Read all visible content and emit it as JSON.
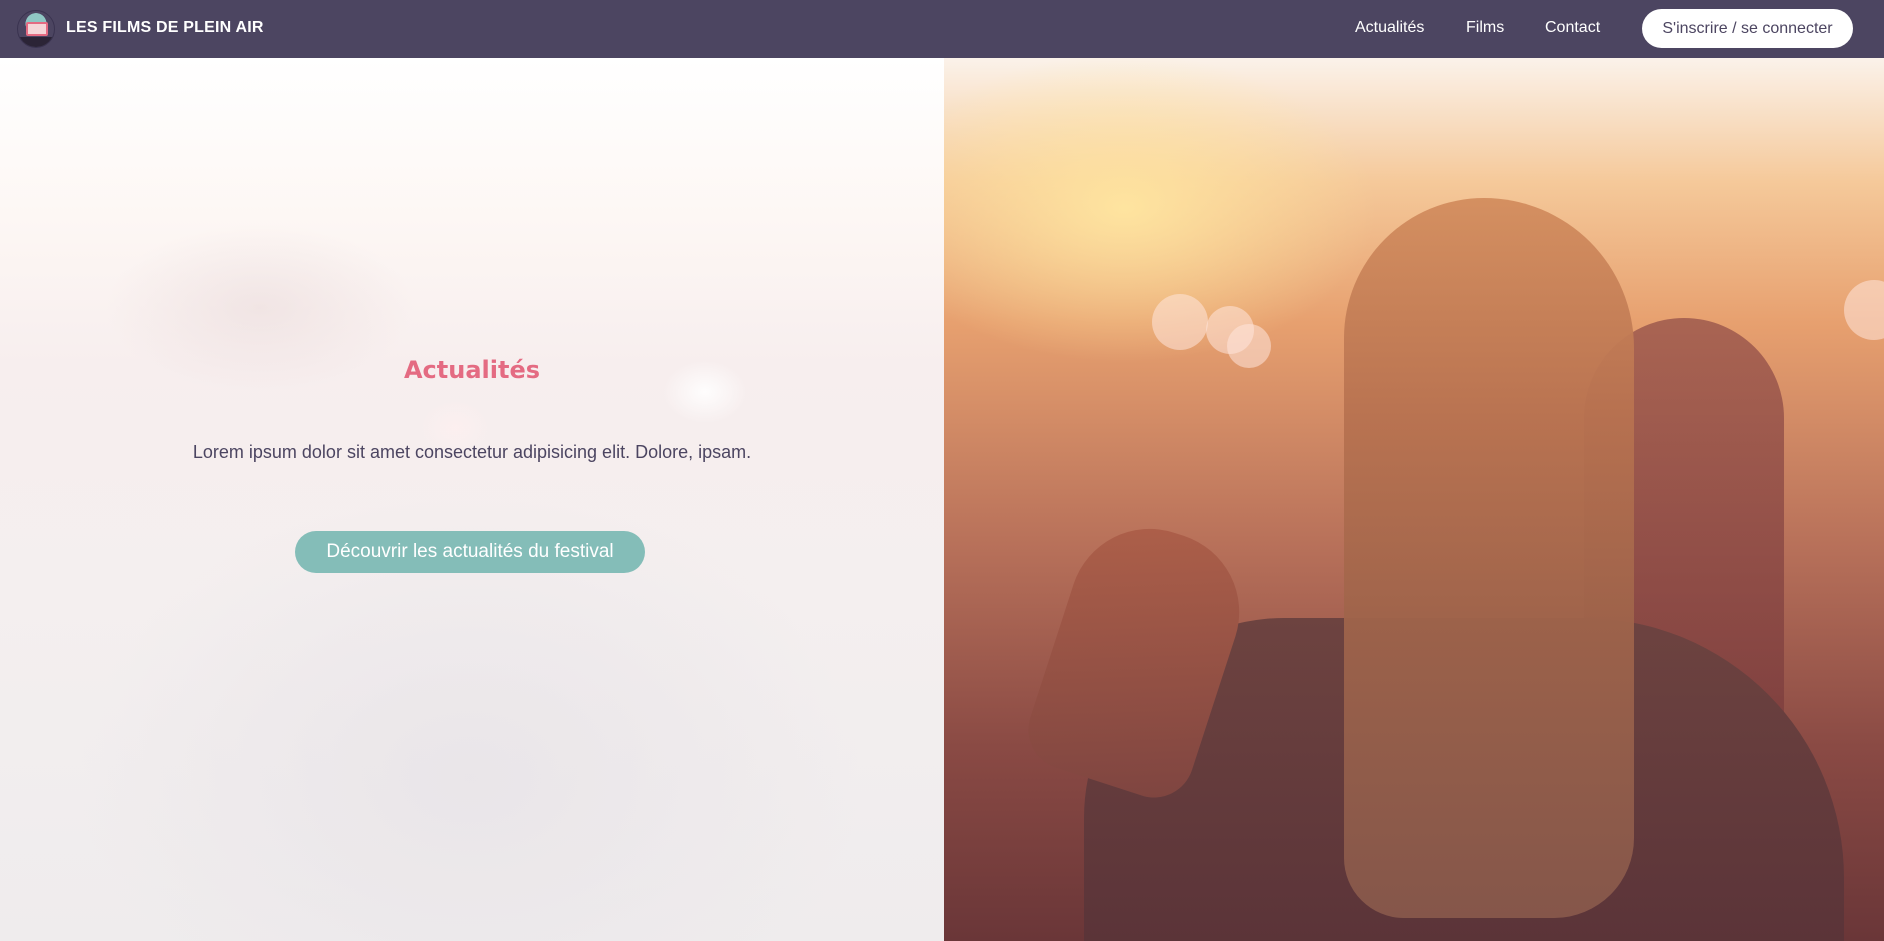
{
  "navbar": {
    "brand": "LES FILMS DE PLEIN AIR",
    "logo_icon": "outdoor-cinema-logo-icon",
    "links": [
      "Actualités",
      "Films",
      "Contact"
    ],
    "signin_label": "S'inscrire / se connecter",
    "background": "#4c4561"
  },
  "hero": {
    "title": "Actualités",
    "text": "Lorem ipsum dolor sit amet consectetur adipisicing elit. Dolore, ipsam.",
    "cta_label": "Découvrir les actualités du festival",
    "title_color": "#e46b82",
    "cta_color": "#84bdb8",
    "image_description_icon": "sunset-crowd-photo"
  }
}
